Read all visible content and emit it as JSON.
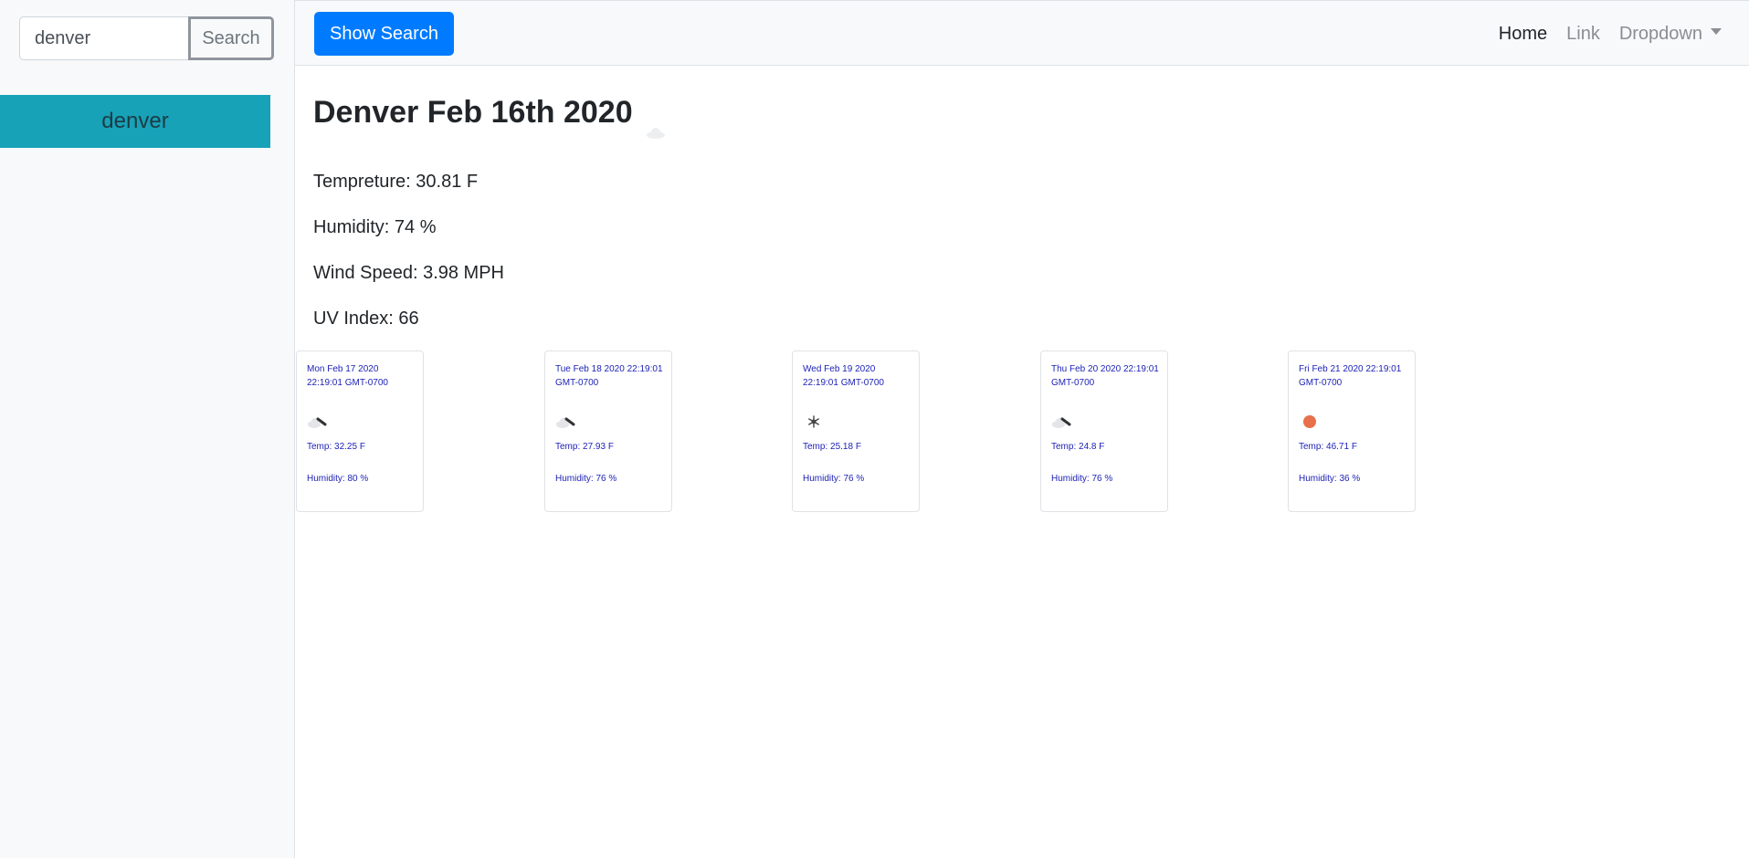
{
  "sidebar": {
    "search_value": "denver",
    "search_button_label": "Search",
    "cities": [
      {
        "label": "denver"
      }
    ]
  },
  "navbar": {
    "show_search_label": "Show Search",
    "links": [
      {
        "label": "Home"
      },
      {
        "label": "Link"
      },
      {
        "label": "Dropdown"
      }
    ]
  },
  "current": {
    "title": "Denver Feb 16th 2020",
    "icon": "cloud-icon",
    "temperature": "Tempreture: 30.81 F",
    "humidity": "Humidity: 74 %",
    "wind": "Wind Speed: 3.98 MPH",
    "uv": "UV Index: 66"
  },
  "forecast": [
    {
      "date": "Mon Feb 17 2020 22:19:01 GMT-0700",
      "icon": "cloud-snow-icon",
      "temp": "Temp: 32.25 F",
      "humidity": "Humidity: 80 %"
    },
    {
      "date": "Tue Feb 18 2020 22:19:01 GMT-0700",
      "icon": "cloud-snow-icon",
      "temp": "Temp: 27.93 F",
      "humidity": "Humidity: 76 %"
    },
    {
      "date": "Wed Feb 19 2020 22:19:01 GMT-0700",
      "icon": "snowflake-icon",
      "temp": "Temp: 25.18 F",
      "humidity": "Humidity: 76 %"
    },
    {
      "date": "Thu Feb 20 2020 22:19:01 GMT-0700",
      "icon": "cloud-snow-icon",
      "temp": "Temp: 24.8 F",
      "humidity": "Humidity: 76 %"
    },
    {
      "date": "Fri Feb 21 2020 22:19:01 GMT-0700",
      "icon": "sun-icon",
      "temp": "Temp: 46.71 F",
      "humidity": "Humidity: 36 %"
    }
  ],
  "colors": {
    "primary": "#007bff",
    "city_item": "#17a2b8",
    "card_text": "#1a1fb5",
    "sun": "#e8704a"
  }
}
